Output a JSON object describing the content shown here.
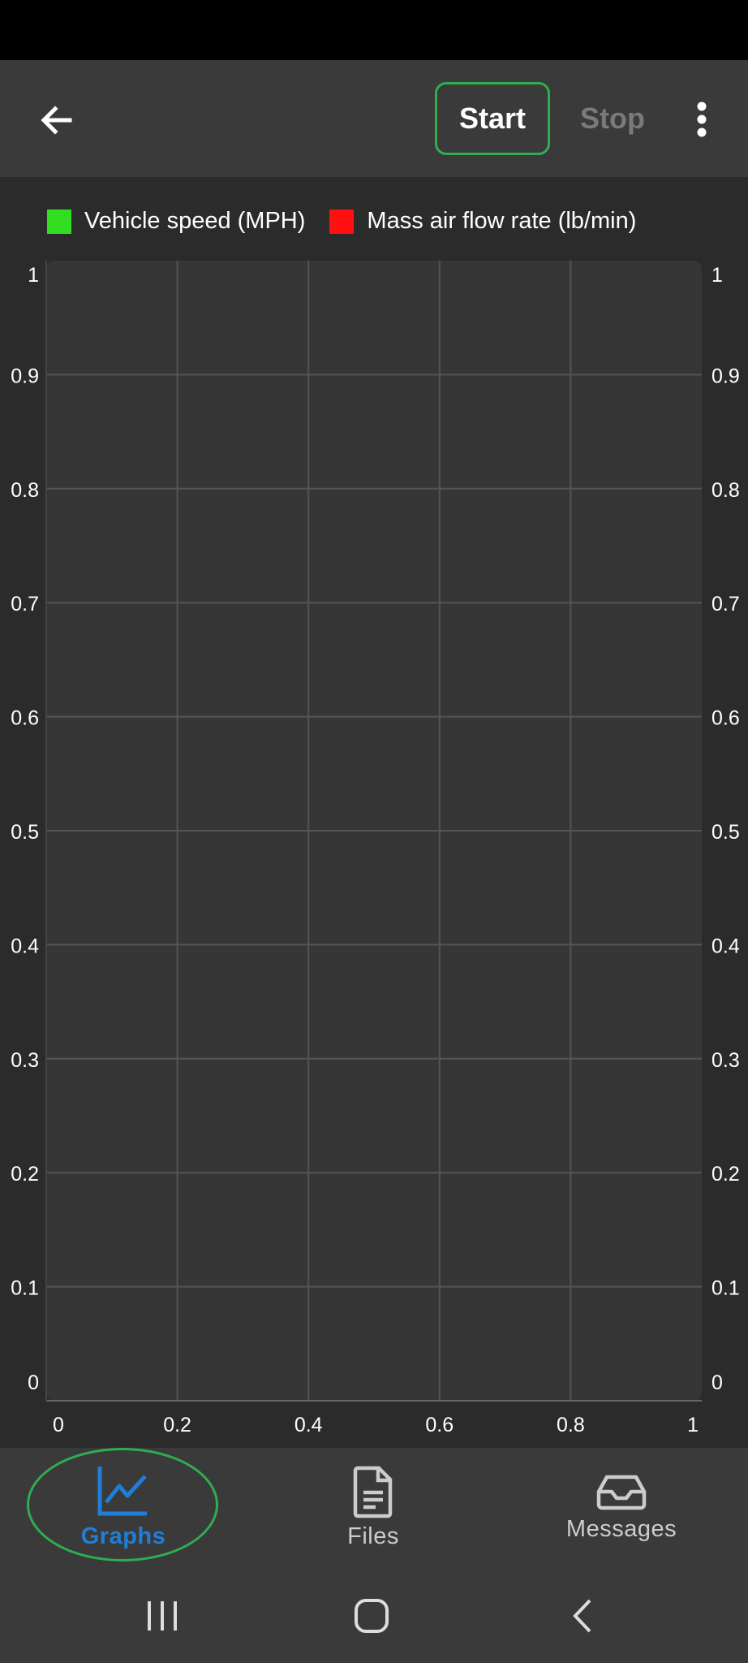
{
  "toolbar": {
    "back_icon": "arrow-left-icon",
    "start_label": "Start",
    "stop_label": "Stop",
    "more_icon": "more-vert-icon"
  },
  "chart_data": {
    "type": "line",
    "title": "",
    "xlabel": "",
    "ylabel": "",
    "x_ticks": [
      "0",
      "0.2",
      "0.4",
      "0.6",
      "0.8",
      "1"
    ],
    "y_ticks": [
      "0",
      "0.1",
      "0.2",
      "0.3",
      "0.4",
      "0.5",
      "0.6",
      "0.7",
      "0.8",
      "0.9",
      "1"
    ],
    "y2_ticks": [
      "0",
      "0.1",
      "0.2",
      "0.3",
      "0.4",
      "0.5",
      "0.6",
      "0.7",
      "0.8",
      "0.9",
      "1"
    ],
    "xlim": [
      0,
      1
    ],
    "ylim": [
      0,
      1
    ],
    "grid": true,
    "legend_position": "top-left",
    "series": [
      {
        "name": "Vehicle speed (MPH)",
        "color": "#33dd22",
        "values": []
      },
      {
        "name": "Mass air flow rate (lb/min)",
        "color": "#ff1111",
        "values": []
      }
    ]
  },
  "bottom_nav": {
    "items": [
      {
        "label": "Graphs",
        "icon": "line-chart-icon",
        "active": true,
        "color": "#1f7ed8"
      },
      {
        "label": "Files",
        "icon": "document-icon",
        "active": false,
        "color": "#cccccc"
      },
      {
        "label": "Messages",
        "icon": "inbox-icon",
        "active": false,
        "color": "#cccccc"
      }
    ]
  },
  "system_nav": {
    "recents_icon": "recents-icon",
    "home_icon": "home-icon",
    "back_icon": "system-back-icon"
  }
}
